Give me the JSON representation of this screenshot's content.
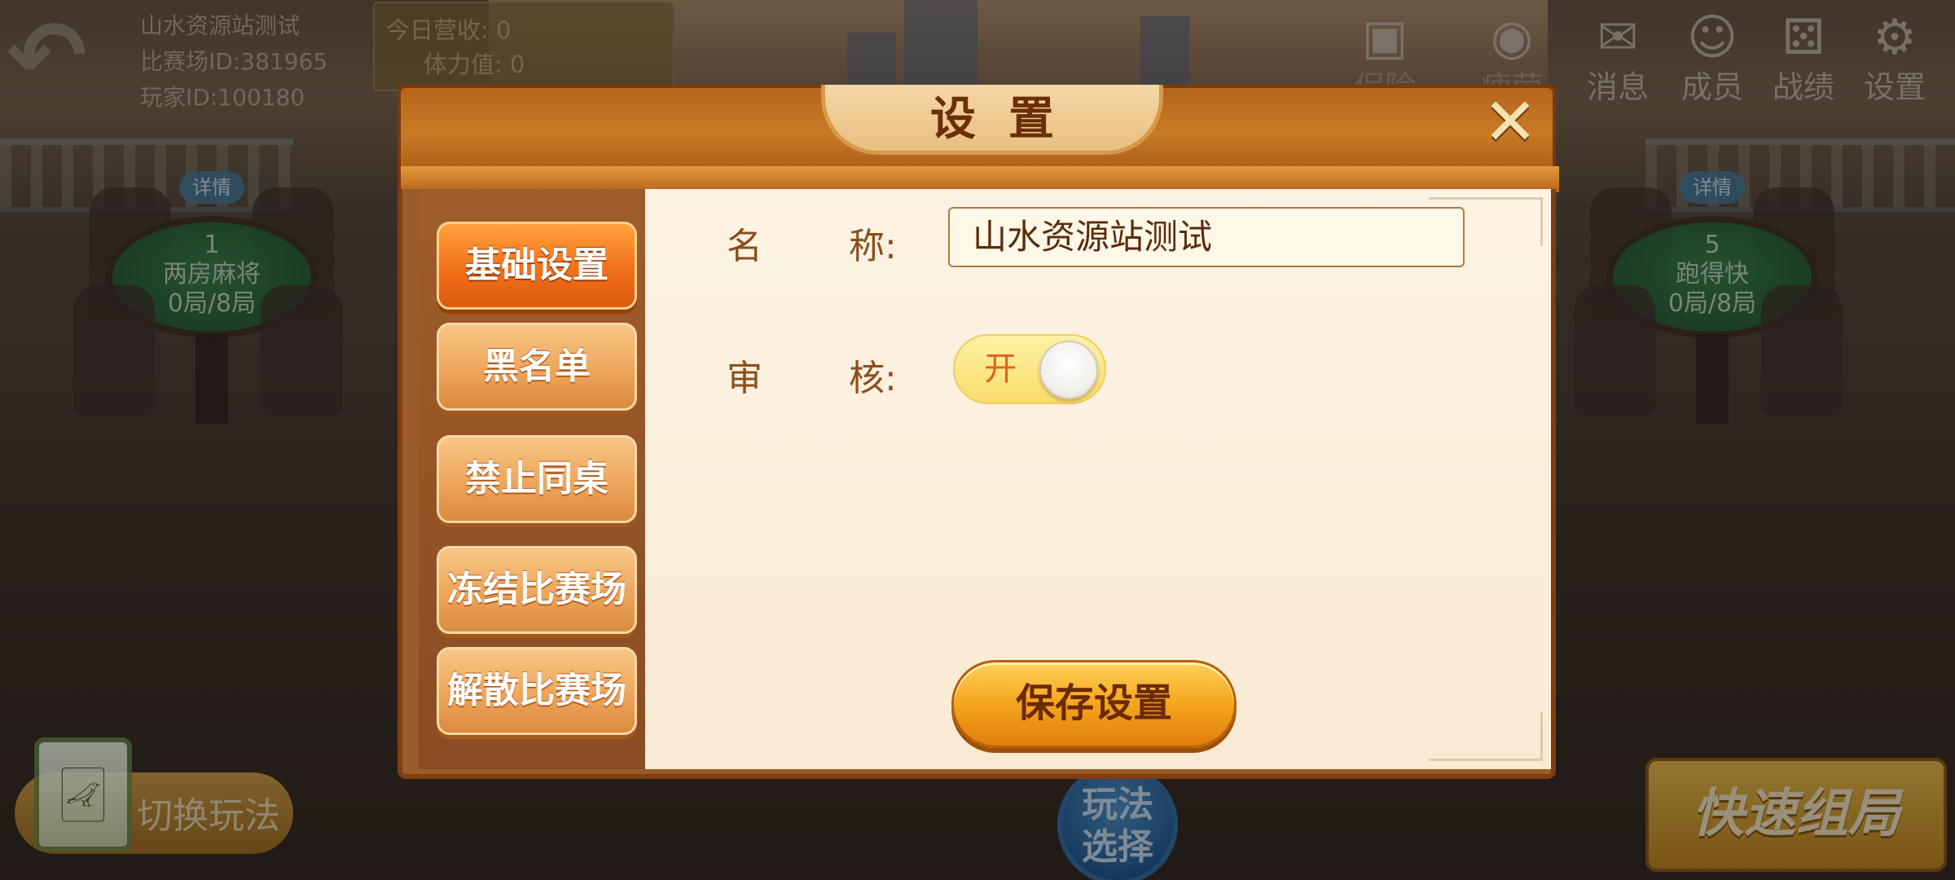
{
  "background": {
    "club_name": "山水资源站测试",
    "arena_id": "比赛场ID:381965",
    "player_id": "玩家ID:100180",
    "stats": {
      "today_revenue": "今日营收: 0",
      "stamina": "体力值: 0"
    },
    "top_icons": [
      {
        "label": "保险箱",
        "icon": "safe-icon"
      },
      {
        "label": "疲劳值",
        "icon": "eye-icon"
      },
      {
        "label": "消息",
        "icon": "mail-icon"
      },
      {
        "label": "成员",
        "icon": "member-icon"
      },
      {
        "label": "战绩",
        "icon": "dice-icon"
      },
      {
        "label": "设置",
        "icon": "gear-icon"
      }
    ],
    "tables": [
      {
        "detail": "详情",
        "number": "1",
        "game": "两房麻将",
        "rounds": "0局/8局"
      },
      {
        "detail": "详情",
        "number": "5",
        "game": "跑得快",
        "rounds": "0局/8局"
      }
    ],
    "switch_label": "切换玩法",
    "mode_select": "玩法选择",
    "quick_match": "快速组局"
  },
  "modal": {
    "title": "设置",
    "close_icon": "close-icon",
    "sidebar": [
      {
        "label": "基础设置",
        "active": true
      },
      {
        "label": "黑名单",
        "active": false
      },
      {
        "label": "禁止同桌",
        "active": false
      },
      {
        "label": "冻结比赛场",
        "active": false
      },
      {
        "label": "解散比赛场",
        "active": false
      }
    ],
    "fields": {
      "name_label_1": "名",
      "name_label_2": "称:",
      "name_value": "山水资源站测试",
      "review_label_1": "审",
      "review_label_2": "核:",
      "review_state": "开",
      "review_on": true
    },
    "save_label": "保存设置"
  },
  "colors": {
    "header": "#b5651d",
    "active_tab": "#f2701a",
    "content_bg": "#fdf3e4",
    "save_button": "#f4a51d"
  }
}
